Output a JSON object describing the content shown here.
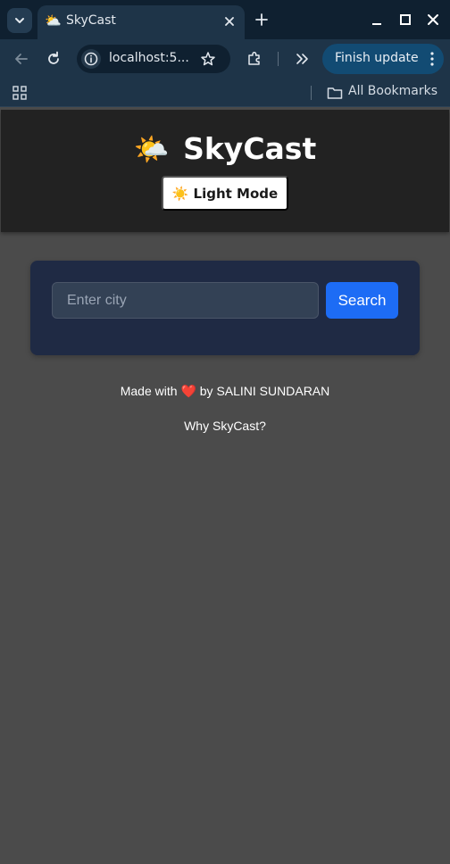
{
  "browser": {
    "tab": {
      "title": "SkyCast",
      "favicon": "⛅"
    },
    "address_bar": {
      "url": "localhost:5..."
    },
    "update_button": {
      "label": "Finish update"
    },
    "bookmarks_bar": {
      "all_bookmarks_label": "All Bookmarks"
    }
  },
  "header": {
    "logo_emoji": "🌤️",
    "title": "SkyCast",
    "mode_toggle": {
      "icon": "☀️",
      "label": "Light Mode"
    }
  },
  "search": {
    "placeholder": "Enter city",
    "value": "",
    "button_label": "Search"
  },
  "footer": {
    "made_with_prefix": "Made with",
    "heart": "❤️",
    "made_with_suffix": "by SALINI SUNDARAN",
    "why_link": "Why SkyCast?"
  },
  "colors": {
    "page_background": "#4b4b4b",
    "header_background": "#222222",
    "card_background": "#1f2a44",
    "search_button": "#1d6cf5",
    "browser_chrome": "#1e3448",
    "update_button": "#124b73"
  }
}
